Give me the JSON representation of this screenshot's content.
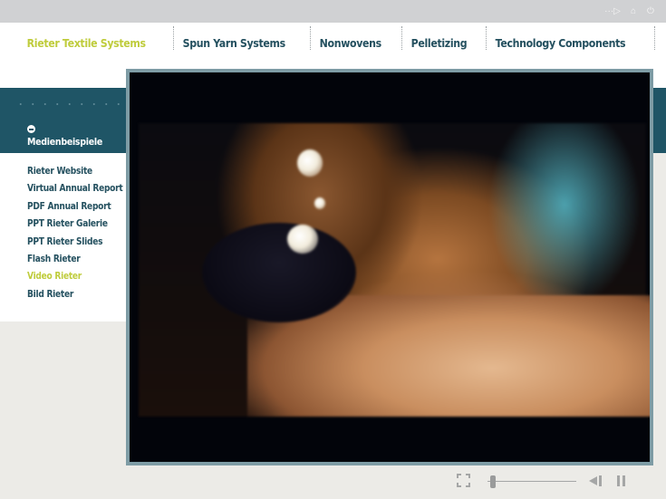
{
  "system_bar": {
    "icons": [
      {
        "name": "speaker-icon",
        "glyph": "···▷"
      },
      {
        "name": "home-icon",
        "glyph": "⌂"
      },
      {
        "name": "power-icon",
        "glyph": "⏻"
      }
    ]
  },
  "main_nav": {
    "items": [
      {
        "label": "Rieter Textile Systems",
        "active": true
      },
      {
        "label": "Spun Yarn Systems",
        "active": false
      },
      {
        "label": "Nonwovens",
        "active": false
      },
      {
        "label": "Pelletizing",
        "active": false
      },
      {
        "label": "Technology Components",
        "active": false
      }
    ],
    "active_color": "#bfcc3c",
    "text_color": "#24505f"
  },
  "sidebar": {
    "section_title": "Medienbeispiele",
    "section_icon": "collapse-minus-icon",
    "items": [
      {
        "label": "Rieter Website",
        "active": false
      },
      {
        "label": "Virtual Annual Report",
        "active": false
      },
      {
        "label": "PDF Annual Report",
        "active": false
      },
      {
        "label": "PPT Rieter Galerie",
        "active": false
      },
      {
        "label": "PPT Rieter Slides",
        "active": false
      },
      {
        "label": "Flash Rieter",
        "active": false
      },
      {
        "label": "Video Rieter",
        "active": true
      },
      {
        "label": "Bild Rieter",
        "active": false
      }
    ],
    "band_color": "#1f5566"
  },
  "video": {
    "content_description": "Woman in profile wearing pearl earrings, dark background",
    "frame_color": "#7e9ca5"
  },
  "player_controls": {
    "fullscreen_icon": "fullscreen-icon",
    "seek_progress": 0.03,
    "rewind_icon": "rewind-icon",
    "pause_icon": "pause-icon"
  }
}
